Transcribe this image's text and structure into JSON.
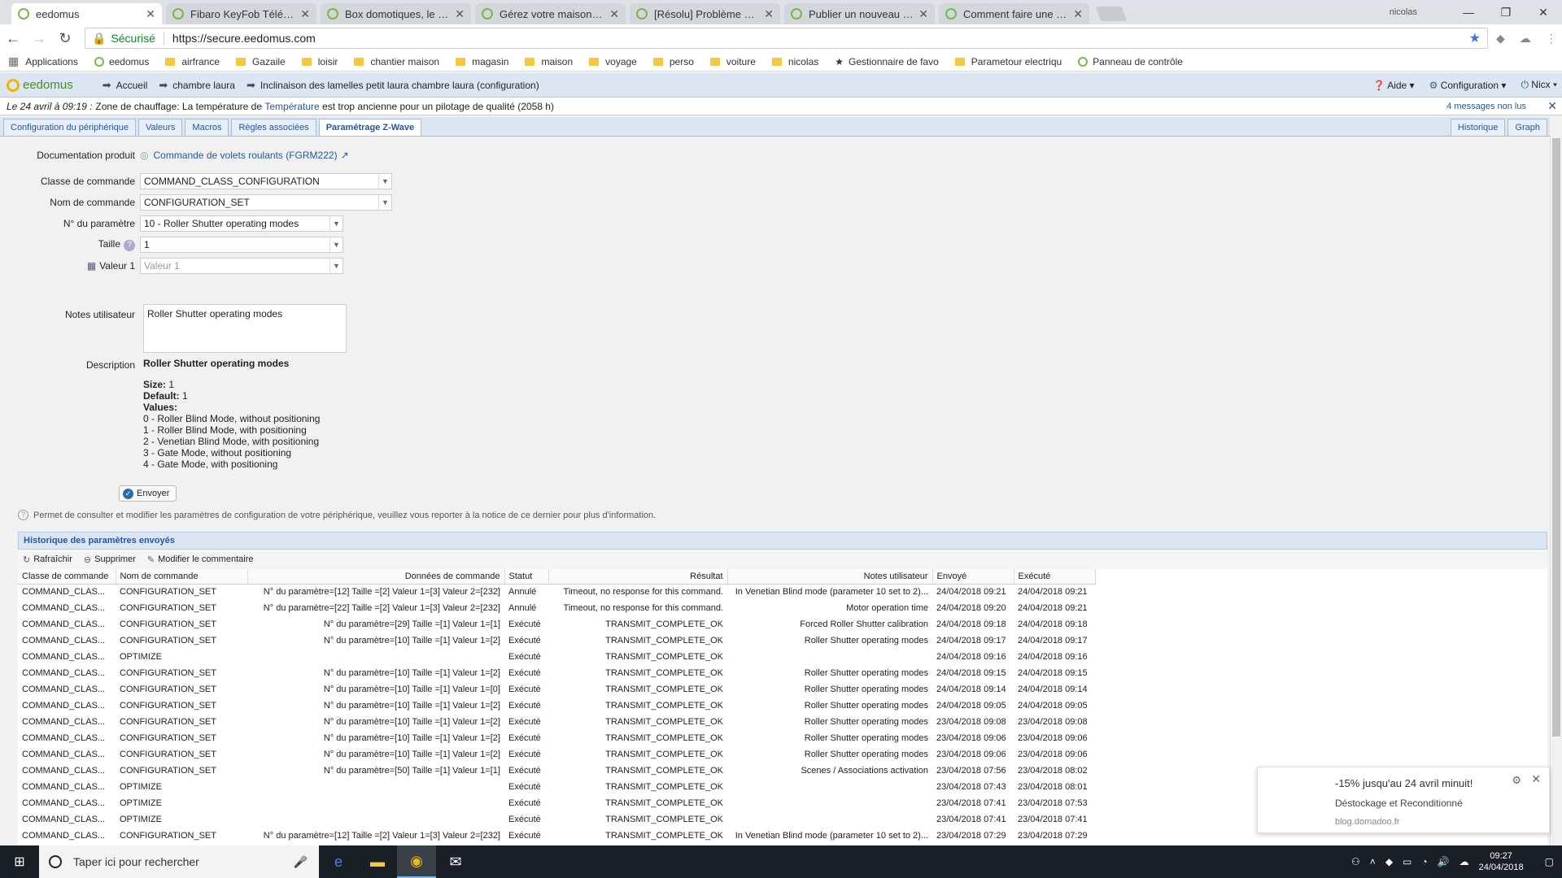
{
  "browser": {
    "tabs": [
      {
        "label": "eedomus",
        "active": true
      },
      {
        "label": "Fibaro KeyFob Télécomm"
      },
      {
        "label": "Box domotiques, le comp"
      },
      {
        "label": "Gérez votre maison à dis"
      },
      {
        "label": "[Résolu] Problème de ret"
      },
      {
        "label": "Publier un nouveau sujet"
      },
      {
        "label": "Comment faire une captu"
      }
    ],
    "user": "nicolas",
    "secure_label": "Sécurisé",
    "url": "https://secure.eedomus.com",
    "bookmarks": [
      "Applications",
      "eedomus",
      "airfrance",
      "Gazaile",
      "loisir",
      "chantier maison",
      "magasin",
      "maison",
      "voyage",
      "perso",
      "voiture",
      "nicolas",
      "Gestionnaire de favo",
      "Parametour electriqu",
      "Panneau de contrôle"
    ]
  },
  "app": {
    "logo": "eedomus",
    "breadcrumb": [
      "Accueil",
      "chambre laura",
      "Inclinaison des lamelles petit laura chambre laura (configuration)"
    ],
    "help_label": "Aide",
    "config_label": "Configuration",
    "user_label": "Nicx",
    "notification": {
      "date": "Le 24 avril à 09:19 :",
      "text_before": "Zone de chauffage: La température de",
      "link": "Température",
      "text_after": "est trop ancienne pour un pilotage de qualité (2058 h)",
      "unread": "4 messages non lus"
    },
    "tabs": [
      "Configuration du périphérique",
      "Valeurs",
      "Macros",
      "Règles associées",
      "Paramétrage Z-Wave"
    ],
    "right_tabs": [
      "Historique",
      "Graph"
    ]
  },
  "form": {
    "doc_label": "Documentation produit",
    "doc_link": "Commande de volets roulants (FGRM222)",
    "class_label": "Classe de commande",
    "class_value": "COMMAND_CLASS_CONFIGURATION",
    "name_label": "Nom de commande",
    "name_value": "CONFIGURATION_SET",
    "param_label": "N° du paramètre",
    "param_value": "10 - Roller Shutter operating modes",
    "size_label": "Taille",
    "size_value": "1",
    "value_label": "Valeur 1",
    "value_placeholder": "Valeur 1",
    "notes_label": "Notes utilisateur",
    "notes_value": "Roller Shutter operating modes",
    "desc_label": "Description",
    "desc_title": "Roller Shutter operating modes",
    "size_k": "Size:",
    "size_v": "1",
    "default_k": "Default:",
    "default_v": "1",
    "values_k": "Values:",
    "values": [
      "0 - Roller Blind Mode, without positioning",
      "1 - Roller Blind Mode, with positioning",
      "2 - Venetian Blind Mode, with positioning",
      "3 - Gate Mode, without positioning",
      "4 - Gate Mode, with positioning"
    ],
    "send_label": "Envoyer",
    "info": "Permet de consulter et modifier les paramètres de configuration de votre périphérique, veuillez vous reporter à la notice de ce dernier pour plus d'information."
  },
  "history": {
    "title": "Historique des paramètres envoyés",
    "toolbar": [
      "Rafraîchir",
      "Supprimer",
      "Modifier le commentaire"
    ],
    "columns": [
      "Classe de commande",
      "Nom de commande",
      "Données de commande",
      "Statut",
      "Résultat",
      "Notes utilisateur",
      "Envoyé",
      "Exécuté"
    ],
    "rows": [
      [
        "COMMAND_CLAS...",
        "CONFIGURATION_SET",
        "N° du paramètre=[12] Taille =[2] Valeur 1=[3] Valeur 2=[232]",
        "Annulé",
        "Timeout, no response for this command.",
        "In Venetian Blind mode (parameter 10 set to 2)...",
        "24/04/2018 09:21",
        "24/04/2018 09:21"
      ],
      [
        "COMMAND_CLAS...",
        "CONFIGURATION_SET",
        "N° du paramètre=[22] Taille =[2] Valeur 1=[3] Valeur 2=[232]",
        "Annulé",
        "Timeout, no response for this command.",
        "Motor operation time",
        "24/04/2018 09:20",
        "24/04/2018 09:21"
      ],
      [
        "COMMAND_CLAS...",
        "CONFIGURATION_SET",
        "N° du paramètre=[29] Taille =[1] Valeur 1=[1]",
        "Exécuté",
        "TRANSMIT_COMPLETE_OK",
        "Forced Roller Shutter calibration",
        "24/04/2018 09:18",
        "24/04/2018 09:18"
      ],
      [
        "COMMAND_CLAS...",
        "CONFIGURATION_SET",
        "N° du paramètre=[10] Taille =[1] Valeur 1=[2]",
        "Exécuté",
        "TRANSMIT_COMPLETE_OK",
        "Roller Shutter operating modes",
        "24/04/2018 09:17",
        "24/04/2018 09:17"
      ],
      [
        "COMMAND_CLAS...",
        "OPTIMIZE",
        "",
        "Exécuté",
        "TRANSMIT_COMPLETE_OK",
        "",
        "24/04/2018 09:16",
        "24/04/2018 09:16"
      ],
      [
        "COMMAND_CLAS...",
        "CONFIGURATION_SET",
        "N° du paramètre=[10] Taille =[1] Valeur 1=[2]",
        "Exécuté",
        "TRANSMIT_COMPLETE_OK",
        "Roller Shutter operating modes",
        "24/04/2018 09:15",
        "24/04/2018 09:15"
      ],
      [
        "COMMAND_CLAS...",
        "CONFIGURATION_SET",
        "N° du paramètre=[10] Taille =[1] Valeur 1=[0]",
        "Exécuté",
        "TRANSMIT_COMPLETE_OK",
        "Roller Shutter operating modes",
        "24/04/2018 09:14",
        "24/04/2018 09:14"
      ],
      [
        "COMMAND_CLAS...",
        "CONFIGURATION_SET",
        "N° du paramètre=[10] Taille =[1] Valeur 1=[2]",
        "Exécuté",
        "TRANSMIT_COMPLETE_OK",
        "Roller Shutter operating modes",
        "24/04/2018 09:05",
        "24/04/2018 09:05"
      ],
      [
        "COMMAND_CLAS...",
        "CONFIGURATION_SET",
        "N° du paramètre=[10] Taille =[1] Valeur 1=[2]",
        "Exécuté",
        "TRANSMIT_COMPLETE_OK",
        "Roller Shutter operating modes",
        "23/04/2018 09:08",
        "23/04/2018 09:08"
      ],
      [
        "COMMAND_CLAS...",
        "CONFIGURATION_SET",
        "N° du paramètre=[10] Taille =[1] Valeur 1=[2]",
        "Exécuté",
        "TRANSMIT_COMPLETE_OK",
        "Roller Shutter operating modes",
        "23/04/2018 09:06",
        "23/04/2018 09:06"
      ],
      [
        "COMMAND_CLAS...",
        "CONFIGURATION_SET",
        "N° du paramètre=[10] Taille =[1] Valeur 1=[2]",
        "Exécuté",
        "TRANSMIT_COMPLETE_OK",
        "Roller Shutter operating modes",
        "23/04/2018 09:06",
        "23/04/2018 09:06"
      ],
      [
        "COMMAND_CLAS...",
        "CONFIGURATION_SET",
        "N° du paramètre=[50] Taille =[1] Valeur 1=[1]",
        "Exécuté",
        "TRANSMIT_COMPLETE_OK",
        "Scenes / Associations activation",
        "23/04/2018 07:56",
        "23/04/2018 08:02"
      ],
      [
        "COMMAND_CLAS...",
        "OPTIMIZE",
        "",
        "Exécuté",
        "TRANSMIT_COMPLETE_OK",
        "",
        "23/04/2018 07:43",
        "23/04/2018 08:01"
      ],
      [
        "COMMAND_CLAS...",
        "OPTIMIZE",
        "",
        "Exécuté",
        "TRANSMIT_COMPLETE_OK",
        "",
        "23/04/2018 07:41",
        "23/04/2018 07:53"
      ],
      [
        "COMMAND_CLAS...",
        "OPTIMIZE",
        "",
        "Exécuté",
        "TRANSMIT_COMPLETE_OK",
        "",
        "23/04/2018 07:41",
        "23/04/2018 07:41"
      ],
      [
        "COMMAND_CLAS...",
        "CONFIGURATION_SET",
        "N° du paramètre=[12] Taille =[2] Valeur 1=[3] Valeur 2=[232]",
        "Exécuté",
        "TRANSMIT_COMPLETE_OK",
        "In Venetian Blind mode (parameter 10 set to 2)...",
        "23/04/2018 07:29",
        "23/04/2018 07:29"
      ]
    ]
  },
  "toast": {
    "title": "-15% jusqu'au 24 avril minuit!",
    "subtitle": "Déstockage et Reconditionné",
    "source": "blog.domadoo.fr"
  },
  "taskbar": {
    "search_placeholder": "Taper ici pour rechercher",
    "time": "09:27",
    "date": "24/04/2018"
  }
}
